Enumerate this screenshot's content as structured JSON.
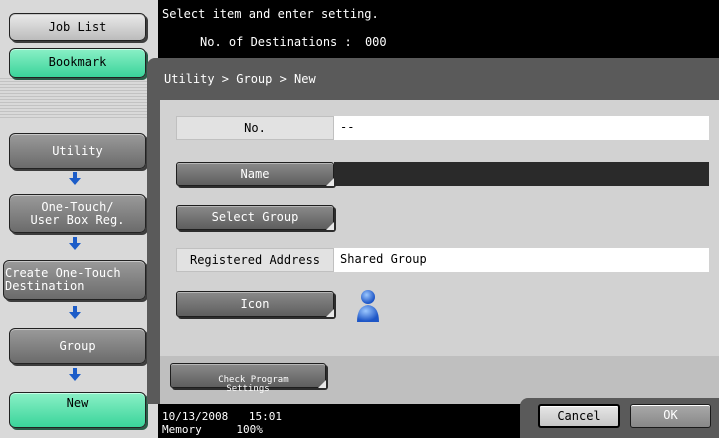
{
  "sidebar": {
    "job_list": "Job List",
    "bookmark": "Bookmark",
    "utility": "Utility",
    "one_touch": "One-Touch/\nUser Box Reg.",
    "create_dest": "Create One-Touch\nDestination",
    "group": "Group",
    "new": "New"
  },
  "header": {
    "message": "Select item and enter setting.",
    "destinations_label": "No. of Destinations :",
    "destinations_value": "000"
  },
  "breadcrumb": "Utility > Group > New",
  "form": {
    "no_label": "No.",
    "no_value": "--",
    "name_button": "Name",
    "name_value": "",
    "select_group_button": "Select Group",
    "registered_address_label": "Registered Address",
    "registered_address_value": "Shared Group",
    "icon_button": "Icon",
    "icon_name": "person-icon"
  },
  "check_program_button": "Check Program\nSettings",
  "footer": {
    "date": "10/13/2008",
    "time": "15:01",
    "memory_label": "Memory",
    "memory_value": "100%",
    "cancel": "Cancel",
    "ok": "OK"
  },
  "colors": {
    "accent_green": "#3ad49a",
    "arrow_blue": "#1c5cc8",
    "icon_blue": "#2a6ad6"
  }
}
